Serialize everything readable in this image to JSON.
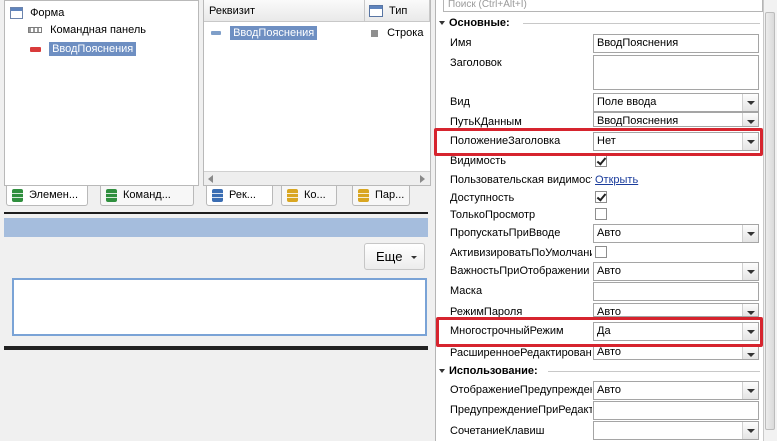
{
  "tree": {
    "items": [
      {
        "label": "Форма"
      },
      {
        "label": "Командная панель"
      },
      {
        "label": "ВводПояснения"
      }
    ],
    "tabs": [
      {
        "label": "Элемен...",
        "color": "#2f8f3e"
      },
      {
        "label": "Команд...",
        "color": "#2f8f3e"
      }
    ]
  },
  "requisites": {
    "col_name": "Реквизит",
    "col_type": "Тип",
    "row": {
      "name": "ВводПояснения",
      "type": "Строка"
    },
    "tabs": [
      {
        "label": "Рек...",
        "color": "#3a6db3"
      },
      {
        "label": "Ко...",
        "color": "#d9a621"
      },
      {
        "label": "Пар...",
        "color": "#d9a621"
      }
    ]
  },
  "form_preview": {
    "more_button_label": "Еще"
  },
  "properties": {
    "search_placeholder": "Поиск (Ctrl+Alt+I)",
    "section_main": "Основные:",
    "section_usage": "Использование:",
    "name_label": "Имя",
    "name_value": "ВводПояснения",
    "title_label": "Заголовок",
    "view_label": "Вид",
    "view_value": "Поле ввода",
    "datapath_label": "ПутьКДанным",
    "datapath_value": "ВводПояснения",
    "title_pos_label": "ПоложениеЗаголовка",
    "title_pos_value": "Нет",
    "visibility_label": "Видимость",
    "user_vis_label": "Пользовательская видимость",
    "user_vis_link": "Открыть",
    "enabled_label": "Доступность",
    "readonly_label": "ТолькоПросмотр",
    "skip_label": "ПропускатьПриВводе",
    "skip_value": "Авто",
    "activate_label": "АктивизироватьПоУмолчанию",
    "importance_label": "ВажностьПриОтображении",
    "importance_value": "Авто",
    "mask_label": "Маска",
    "password_label": "РежимПароля",
    "password_value": "Авто",
    "multiline_label": "МногострочныйРежим",
    "multiline_value": "Да",
    "ext_edit_label": "РасширенноеРедактирование",
    "ext_edit_value": "Авто",
    "warn_disp_label": "ОтображениеПредупреждения",
    "warn_disp_value": "Авто",
    "warn_edit_label": "ПредупреждениеПриРедактировании",
    "shortcut_label": "СочетаниеКлавиш"
  },
  "colors": {
    "selection": "#6e8fc2",
    "highlight_box": "#d6242e",
    "form_strip": "#a5bddd"
  }
}
